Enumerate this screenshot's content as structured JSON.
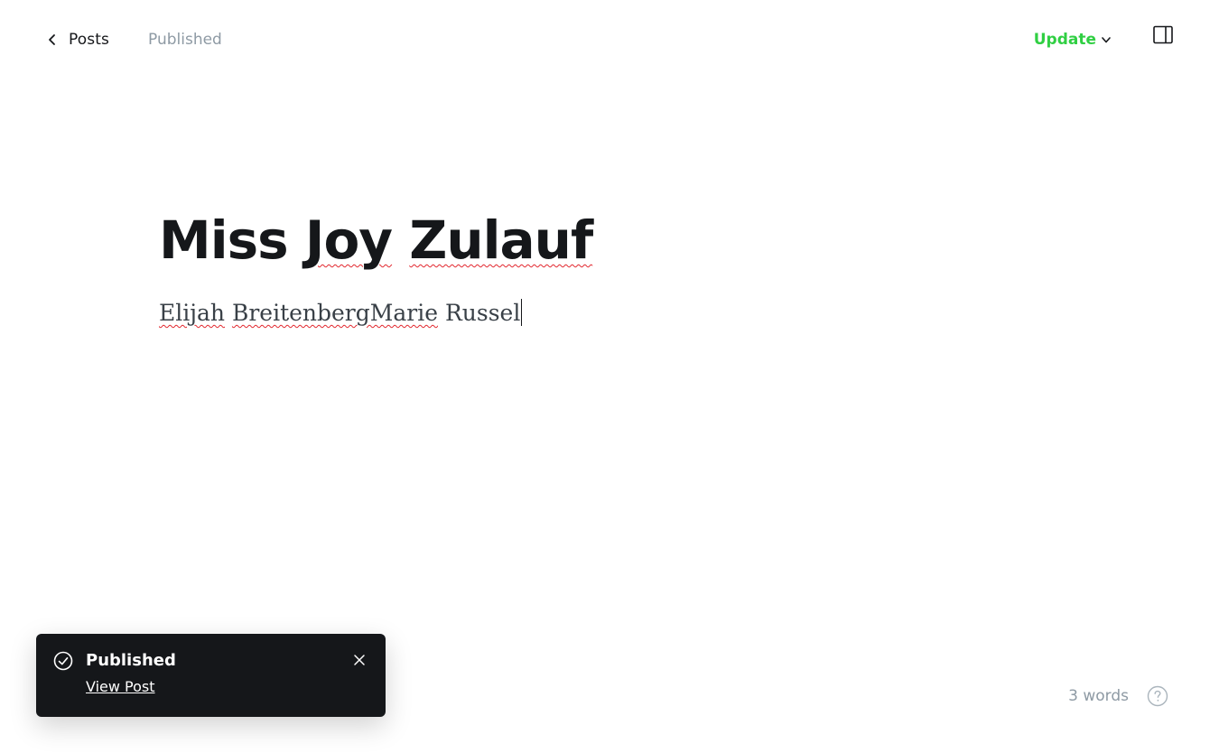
{
  "header": {
    "back_label": "Posts",
    "status": "Published",
    "update_label": "Update"
  },
  "editor": {
    "title_words": [
      "Miss",
      "Joy",
      "Zulauf"
    ],
    "body_words": [
      "Elijah",
      "BreitenbergMarie",
      "Russel"
    ]
  },
  "toast": {
    "title": "Published",
    "link_label": "View Post"
  },
  "footer": {
    "word_count": "3 words"
  },
  "colors": {
    "accent": "#30cf43",
    "muted": "#8e9aa4",
    "text": "#15171a",
    "toast_bg": "#15171a",
    "spellcheck": "#e2272e"
  },
  "icons": {
    "back": "chevron-left-icon",
    "update_dropdown": "chevron-down-icon",
    "sidebar": "sidebar-toggle-icon",
    "toast_status": "check-circle-icon",
    "toast_close": "close-icon",
    "help": "question-circle-icon"
  }
}
